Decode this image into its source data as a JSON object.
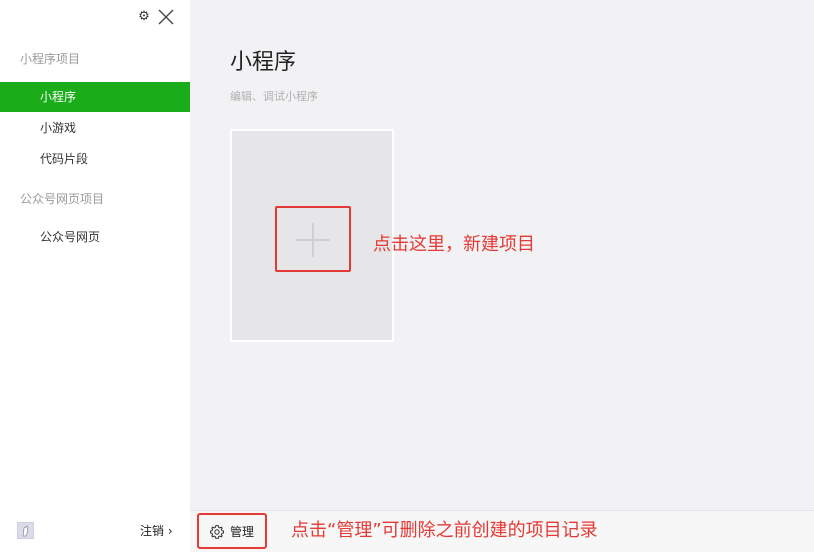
{
  "window": {
    "settings_icon": "gear-icon",
    "close_icon": "close-icon"
  },
  "sidebar": {
    "sections": [
      {
        "label": "小程序项目",
        "items": [
          {
            "label": "小程序",
            "active": true
          },
          {
            "label": "小游戏",
            "active": false
          },
          {
            "label": "代码片段",
            "active": false
          }
        ]
      },
      {
        "label": "公众号网页项目",
        "items": [
          {
            "label": "公众号网页",
            "active": false
          }
        ]
      }
    ],
    "footer": {
      "avatar_icon": "avatar",
      "logout_label": "注销 ›"
    }
  },
  "main": {
    "title": "小程序",
    "subtitle": "编辑、调试小程序",
    "new_card_icon": "plus-icon",
    "manage_label": "管理"
  },
  "annotations": {
    "new_project": "点击这里，新建项目",
    "manage": "点击“管理”可删除之前创建的项目记录"
  },
  "colors": {
    "accent_green": "#1aad19",
    "annotation_red": "#e53935",
    "main_bg": "#f2f2f4",
    "card_bg": "#e6e6e8"
  }
}
